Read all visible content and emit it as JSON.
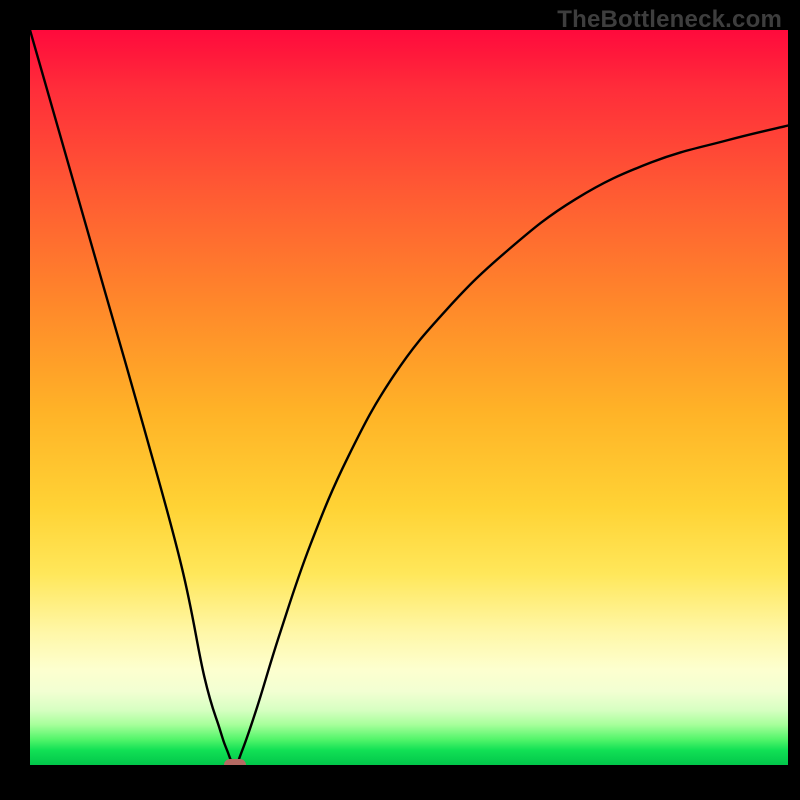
{
  "watermark": "TheBottleneck.com",
  "chart_data": {
    "type": "line",
    "title": "",
    "xlabel": "",
    "ylabel": "",
    "xlim": [
      0,
      100
    ],
    "ylim": [
      0,
      100
    ],
    "grid": false,
    "series": [
      {
        "name": "bottleneck-curve",
        "x": [
          0,
          5,
          10,
          15,
          20,
          23,
          25,
          26,
          27,
          28,
          30,
          33,
          37,
          42,
          48,
          55,
          63,
          72,
          82,
          92,
          100
        ],
        "y": [
          100,
          82,
          64,
          46,
          27,
          12,
          5,
          2,
          0,
          2,
          8,
          18,
          30,
          42,
          53,
          62,
          70,
          77,
          82,
          85,
          87
        ]
      }
    ],
    "annotations": [
      {
        "name": "minimum-marker",
        "x": 27,
        "y": 0,
        "shape": "pill",
        "color": "#b56a63"
      }
    ],
    "background_gradient": {
      "top": "#ff0a3c",
      "mid": "#ffd335",
      "bottom": "#02c64a"
    }
  }
}
